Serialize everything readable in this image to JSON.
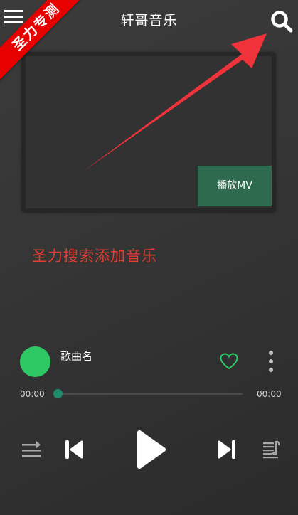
{
  "banner": {
    "text": "圣力专测"
  },
  "header": {
    "title": "轩哥音乐"
  },
  "video": {
    "play_mv_label": "播放MV"
  },
  "annotation": {
    "text": "圣力搜索添加音乐"
  },
  "player": {
    "song_name": "歌曲名",
    "time_current": "00:00",
    "time_total": "00:00",
    "progress": 0
  },
  "icons": {
    "menu": "menu-icon",
    "search": "search-icon",
    "heart": "heart-outline-icon",
    "more": "more-vertical-icon",
    "mode": "play-mode-icon",
    "previous": "skip-previous-icon",
    "play": "play-icon",
    "next": "skip-next-icon",
    "playlist": "playlist-icon"
  },
  "colors": {
    "accent_green": "#2ec865",
    "mv_button": "#2e6a4e",
    "annotation_red": "#e63a32",
    "banner_red": "#e60000",
    "progress_thumb": "#1e8d6d"
  }
}
